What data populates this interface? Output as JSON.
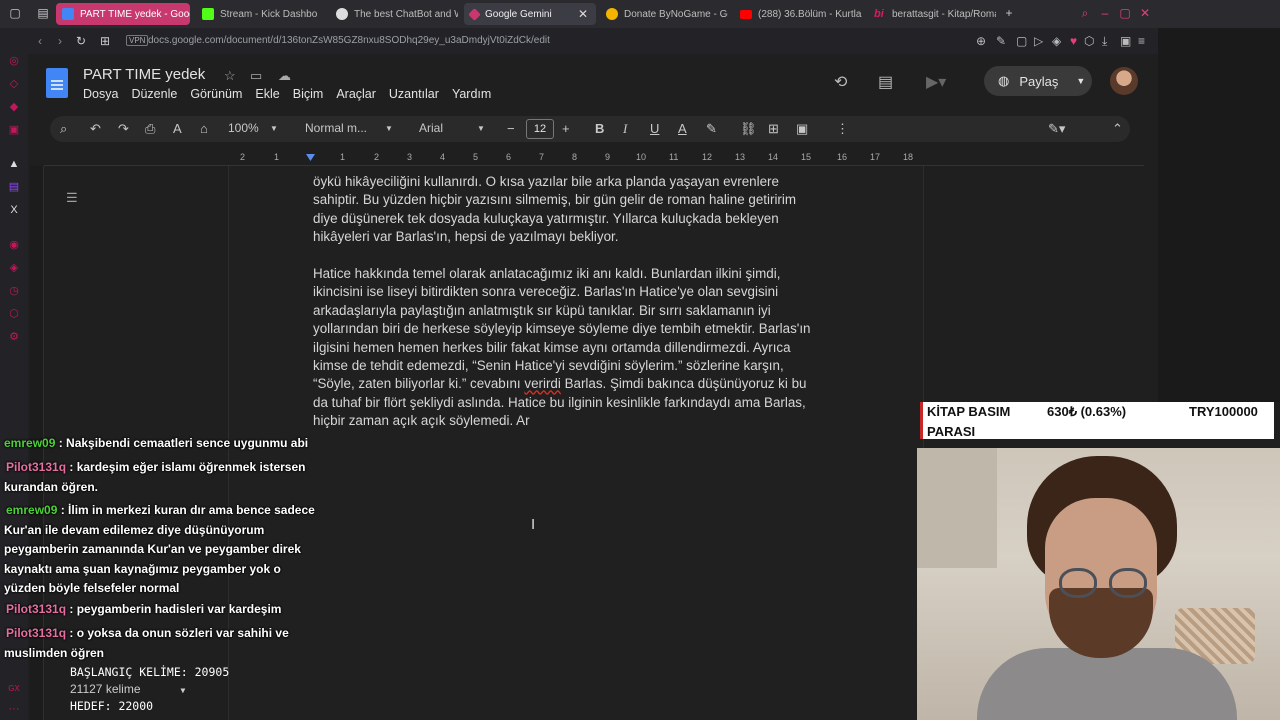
{
  "browser": {
    "tabs": [
      {
        "label": "PART TIME yedek - Goog",
        "color": "#c7386e"
      },
      {
        "label": "Stream - Kick Dashbo",
        "color": "#53fc18"
      },
      {
        "label": "The best ChatBot and Wi",
        "color": "#ffffff"
      },
      {
        "label": "Google Gemini",
        "color": "#c7386e"
      },
      {
        "label": "Donate ByNoGame - Gele",
        "color": "#f4b400"
      },
      {
        "label": "(288) 36.Bölüm - Kurtlar",
        "color": "#ff0000"
      },
      {
        "label": "berattasgit - Kitap/Roman",
        "color": "#d81b60"
      }
    ],
    "vpn_label": "VPN",
    "url": "docs.google.com/document/d/136tonZsW85GZ8nxu8SODhq29ey_u3aDmdyjVt0iZdCk/edit"
  },
  "docs": {
    "title": "PART TIME yedek",
    "menu": [
      "Dosya",
      "Düzenle",
      "Görünüm",
      "Ekle",
      "Biçim",
      "Araçlar",
      "Uzantılar",
      "Yardım"
    ],
    "share_label": "Paylaş",
    "toolbar": {
      "zoom": "100%",
      "style": "Normal m...",
      "font": "Arial",
      "font_size": "12"
    },
    "ruler": [
      "2",
      "1",
      "1",
      "2",
      "3",
      "4",
      "5",
      "6",
      "7",
      "8",
      "9",
      "10",
      "11",
      "12",
      "13",
      "14",
      "15",
      "16",
      "17",
      "18"
    ],
    "paragraphs": [
      {
        "lines": [
          "öykü hikâyeciliğini kullanırdı. O kısa yazılar bile arka planda yaşayan evrenlere",
          "sahiptir. Bu yüzden hiçbir yazısını silmemiş, bir gün gelir de roman haline getiririm",
          "diye düşünerek tek dosyada kuluçkaya yatırmıştır. Yıllarca kuluçkada bekleyen",
          "hikâyeleri var Barlas'ın, hepsi de yazılmayı bekliyor."
        ]
      },
      {
        "lines": [
          "Hatice hakkında temel olarak anlatacağımız iki anı kaldı. Bunlardan ilkini şimdi,",
          "ikincisini ise liseyi bitirdikten sonra vereceğiz. Barlas'ın Hatice'ye olan sevgisini",
          "arkadaşlarıyla paylaştığın anlatmıştık sır küpü tanıklar. Bir sırrı saklamanın iyi",
          "yollarından biri de herkese söyleyip kimseye söyleme diye tembih etmektir. Barlas'ın",
          "ilgisini hemen hemen herkes bilir fakat kimse aynı ortamda dillendirmezdi. Ayrıca",
          "kimse de tehdit edemezdi, “Senin Hatice'yi sevdiğini söylerim.” sözlerine karşın,"
        ],
        "line7_pre": "“Söyle, zaten biliyorlar ki.” cevabını ",
        "line7_err": "verirdi",
        "line7_post": " Barlas. Şimdi bakınca düşünüyoruz ki bu",
        "lines_end": [
          "da tuhaf bir flört şekliydi aslında. Hatice bu ilginin kesinlikle farkındaydı ama Barlas,",
          "hiçbir zaman açık açık söylemedi. Ar"
        ]
      }
    ]
  },
  "chat": [
    {
      "user": "emrew09",
      "user_color": "#4cd137",
      "text": " : Nakşibendi cemaatleri sence uygunmu abi"
    },
    {
      "user": "Pilot3131q",
      "user_color": "#e76fa1",
      "text": " : kardeşim eğer islamı öğrenmek istersen kurandan öğren."
    },
    {
      "user": "emrew09",
      "user_color": "#4cd137",
      "text": " : İlim in merkezi kuran dır ama bence sadece Kur'an ile devam edilemez diye düşünüyorum peygamberin zamanında Kur'an ve peygamber direk kaynaktı ama şuan kaynağımız peygamber yok o yüzden böyle felsefeler normal"
    },
    {
      "user": "Pilot3131q",
      "user_color": "#e76fa1",
      "text": " : peygamberin hadisleri var kardeşim"
    },
    {
      "user": "Pilot3131q",
      "user_color": "#e76fa1",
      "text": " : o yoksa da onun sözleri var sahihi ve muslimden öğren"
    }
  ],
  "wordcount": {
    "start": "BAŞLANGIÇ KELİME: 20905",
    "current": "21127 kelime",
    "goal": "HEDEF: 22000"
  },
  "ticker": {
    "label": "KİTAP BASIM PARASI",
    "label1": "KİTAP BASIM",
    "label2": "PARASI",
    "amount": "630₺ (0.63%)",
    "goal": "TRY100000"
  },
  "icons": [
    "search-icon",
    "undo-icon",
    "redo-icon",
    "print-icon",
    "spellcheck-icon",
    "paint-format-icon",
    "bold-icon",
    "italic-icon",
    "underline-icon",
    "text-color-icon",
    "highlight-icon",
    "link-icon",
    "comment-icon",
    "image-icon",
    "more-icon",
    "history-icon",
    "comments-icon",
    "meet-icon",
    "globe-icon",
    "outline-icon"
  ]
}
